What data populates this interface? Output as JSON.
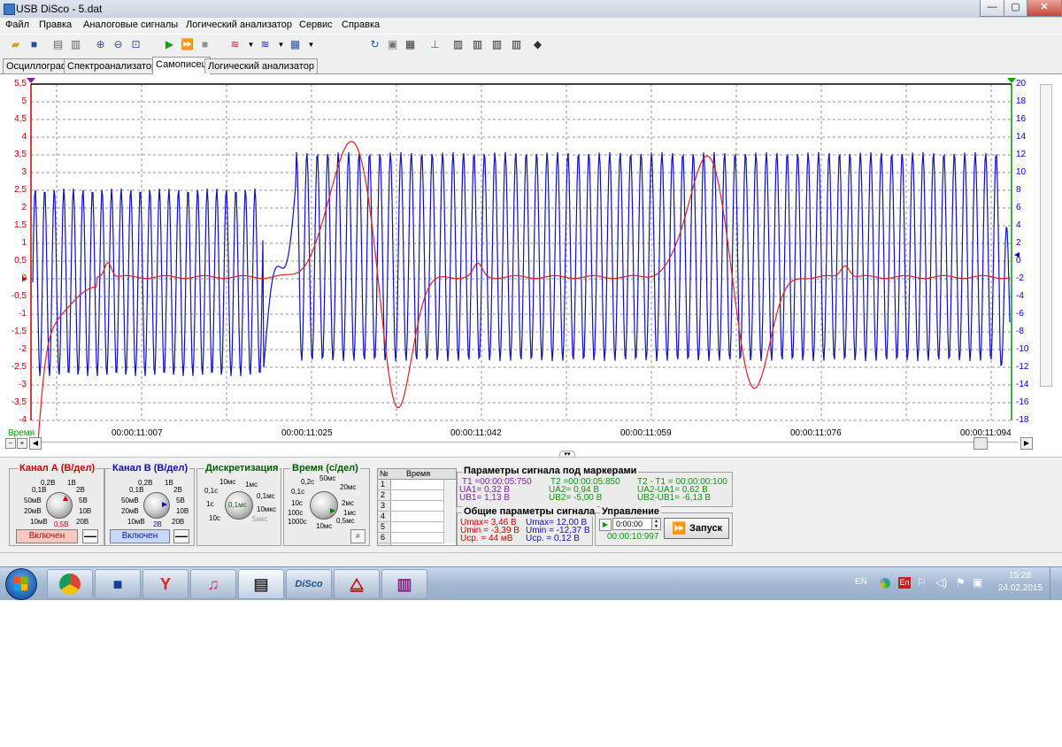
{
  "window": {
    "title": "USB DiSco - 5.dat",
    "controls": [
      "—",
      "▢",
      "✕"
    ]
  },
  "menu": [
    "Файл",
    "Правка",
    "Аналоговые сигналы",
    "Логический анализатор",
    "Сервис",
    "Справка"
  ],
  "tabs": [
    {
      "label": "Осциллограф",
      "active": false
    },
    {
      "label": "Спектроанализатор",
      "active": false
    },
    {
      "label": "Самописец",
      "active": true
    },
    {
      "label": "Логический анализатор",
      "active": false
    }
  ],
  "plot": {
    "y_left_ticks": [
      "5,5",
      "5",
      "4,5",
      "4",
      "3,5",
      "3",
      "2,5",
      "2",
      "1,5",
      "1",
      "0,5",
      "0",
      "-0,5",
      "-1",
      "-1,5",
      "-2",
      "-2,5",
      "-3",
      "-3,5",
      "-4"
    ],
    "y_right_ticks": [
      "20",
      "18",
      "16",
      "14",
      "12",
      "10",
      "8",
      "6",
      "4",
      "2",
      "0",
      "-2",
      "-4",
      "-6",
      "-8",
      "-10",
      "-12",
      "-14",
      "-16",
      "-18"
    ],
    "x_axis_label": "Время",
    "x_ticks": [
      "00:00:11:007",
      "00:00:11:025",
      "00:00:11:042",
      "00:00:11:059",
      "00:00:11:076",
      "00:00:11:094"
    ],
    "colors": {
      "channel_a": "#e02020",
      "channel_b": "#1010c0",
      "grid": "#909090",
      "left_axis": "#cc0000",
      "right_axis": "#009900"
    }
  },
  "chan_a": {
    "title": "Канал А (В/дел)",
    "labels": [
      "0,2В",
      "1В",
      "0,1В",
      "2В",
      "50мВ",
      "5В",
      "20мВ",
      "10В",
      "10мВ",
      "20В"
    ],
    "value": "0,5В",
    "button": "Включен"
  },
  "chan_b": {
    "title": "Канал В (В/дел)",
    "labels": [
      "0,2В",
      "1В",
      "0,1В",
      "2В",
      "50мВ",
      "5В",
      "20мВ",
      "10В",
      "10мВ",
      "20В"
    ],
    "value": "2В",
    "button": "Включен"
  },
  "disc": {
    "title": "Дискретизация",
    "labels": [
      "10мс",
      "1мс",
      "0,1с",
      "0,1мс",
      "1с",
      "10мкс",
      "10с",
      "5мкс"
    ],
    "value": "0,1мс"
  },
  "timediv": {
    "title": "Время (с/дел)",
    "labels": [
      "0,2с",
      "50мс",
      "0,1с",
      "20мс",
      "10с",
      "2мс",
      "100с",
      "1мс",
      "1000с",
      "0,5мс",
      "10мс"
    ]
  },
  "marker_table": {
    "col_no": "№",
    "col_time": "Время",
    "rows": [
      "1",
      "2",
      "3",
      "4",
      "5",
      "6"
    ]
  },
  "marker_params": {
    "title": "Параметры сигнала под маркерами",
    "t1": "T1 =00:00:05:750",
    "t2": "T2 =00:00:05:850",
    "dt": "T2 - T1 = 00:00:00:100",
    "ua1": "UA1= 0,32 В",
    "ua2": "UA2= 0,94 В",
    "dua": "UA2-UA1= 0,62 В",
    "ub1": "UB1= 1,13 В",
    "ub2": "UB2= -5,00 В",
    "dub": "UB2-UB1= -6,13 В"
  },
  "general_params": {
    "title": "Общие параметры сигнала",
    "a_max": "Umax= 3,46 В",
    "a_min": "Umin = -3,39 В",
    "a_avg": "Ucp. = 44 мВ",
    "b_max": "Umax= 12,00 В",
    "b_min": "Umin = -12,37 В",
    "b_avg": "Ucp. = 0,12 В"
  },
  "control": {
    "title": "Управление",
    "time_input": "0:00:00",
    "elapsed": "00:00:10:997",
    "start_button": "Запуск"
  },
  "taskbar": {
    "lang": "EN",
    "lang_tray": "En",
    "time": "15:28",
    "date": "24.02.2015"
  }
}
